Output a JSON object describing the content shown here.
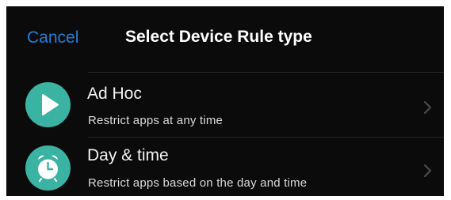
{
  "header": {
    "cancel_label": "Cancel",
    "title": "Select Device Rule type"
  },
  "rules": [
    {
      "title": "Ad Hoc",
      "subtitle": "Restrict apps at any time",
      "icon": "play-icon"
    },
    {
      "title": "Day & time",
      "subtitle": "Restrict apps based on the day and time",
      "icon": "alarm-clock-icon"
    }
  ],
  "colors": {
    "background": "#0b0b0c",
    "accent": "#1f7fd8",
    "icon_teal": "#3bb3a3",
    "text": "#f2f2f2",
    "chevron": "#4a4a4c"
  }
}
